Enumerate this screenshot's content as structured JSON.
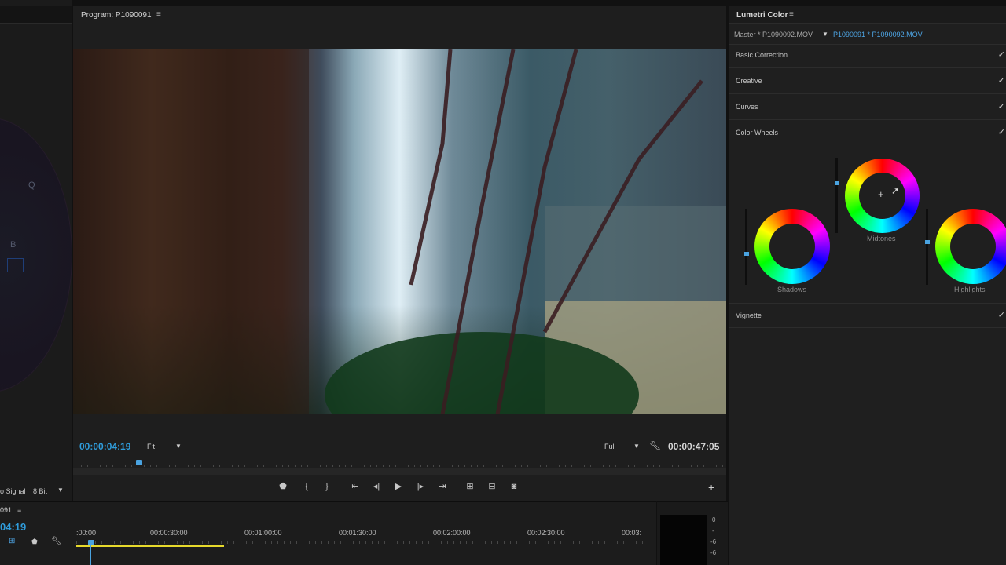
{
  "scope": {
    "labels": {
      "q": "Q",
      "b": "B"
    },
    "footer": {
      "signal": "o Signal",
      "bitdepth": "8 Bit"
    }
  },
  "program": {
    "title": "Program: P1090091",
    "menu_icon": "≡",
    "timecode_current": "00:00:04:19",
    "zoom_select": "Fit",
    "quality_select": "Full",
    "timecode_duration": "00:00:47:05",
    "transport": {
      "marker": "marker-icon",
      "in": "{",
      "out": "}",
      "go_in": "go-to-in-icon",
      "step_back": "step-back-icon",
      "play": "play-icon",
      "step_fwd": "step-forward-icon",
      "go_out": "go-to-out-icon",
      "lift": "lift-icon",
      "extract": "extract-icon",
      "export_frame": "camera-icon",
      "add": "+"
    }
  },
  "lumetri": {
    "title": "Lumetri Color",
    "menu_icon": "≡",
    "source_master": "Master * P1090092.MOV",
    "source_clip": "P1090091 * P1090092.MOV",
    "sections": [
      {
        "name": "Basic Correction",
        "check": "✓"
      },
      {
        "name": "Creative",
        "check": "✓"
      },
      {
        "name": "Curves",
        "check": "✓"
      },
      {
        "name": "Color Wheels",
        "check": "✓"
      },
      {
        "name": "Vignette",
        "check": "✓"
      }
    ],
    "wheels": {
      "shadows": "Shadows",
      "midtones": "Midtones",
      "highlights": "Highlights"
    },
    "crosshair": "+"
  },
  "timeline": {
    "seq_name": "091",
    "menu_icon": "≡",
    "timecode": "04:19",
    "ruler": [
      ":00:00",
      "00:00:30:00",
      "00:01:00:00",
      "00:01:30:00",
      "00:02:00:00",
      "00:02:30:00",
      "00:03:"
    ]
  },
  "meter": {
    "labels": [
      "0",
      "-",
      "-6",
      "-6"
    ]
  },
  "colors": {
    "accent": "#2f9cdb",
    "work_area": "#e6d92c"
  }
}
